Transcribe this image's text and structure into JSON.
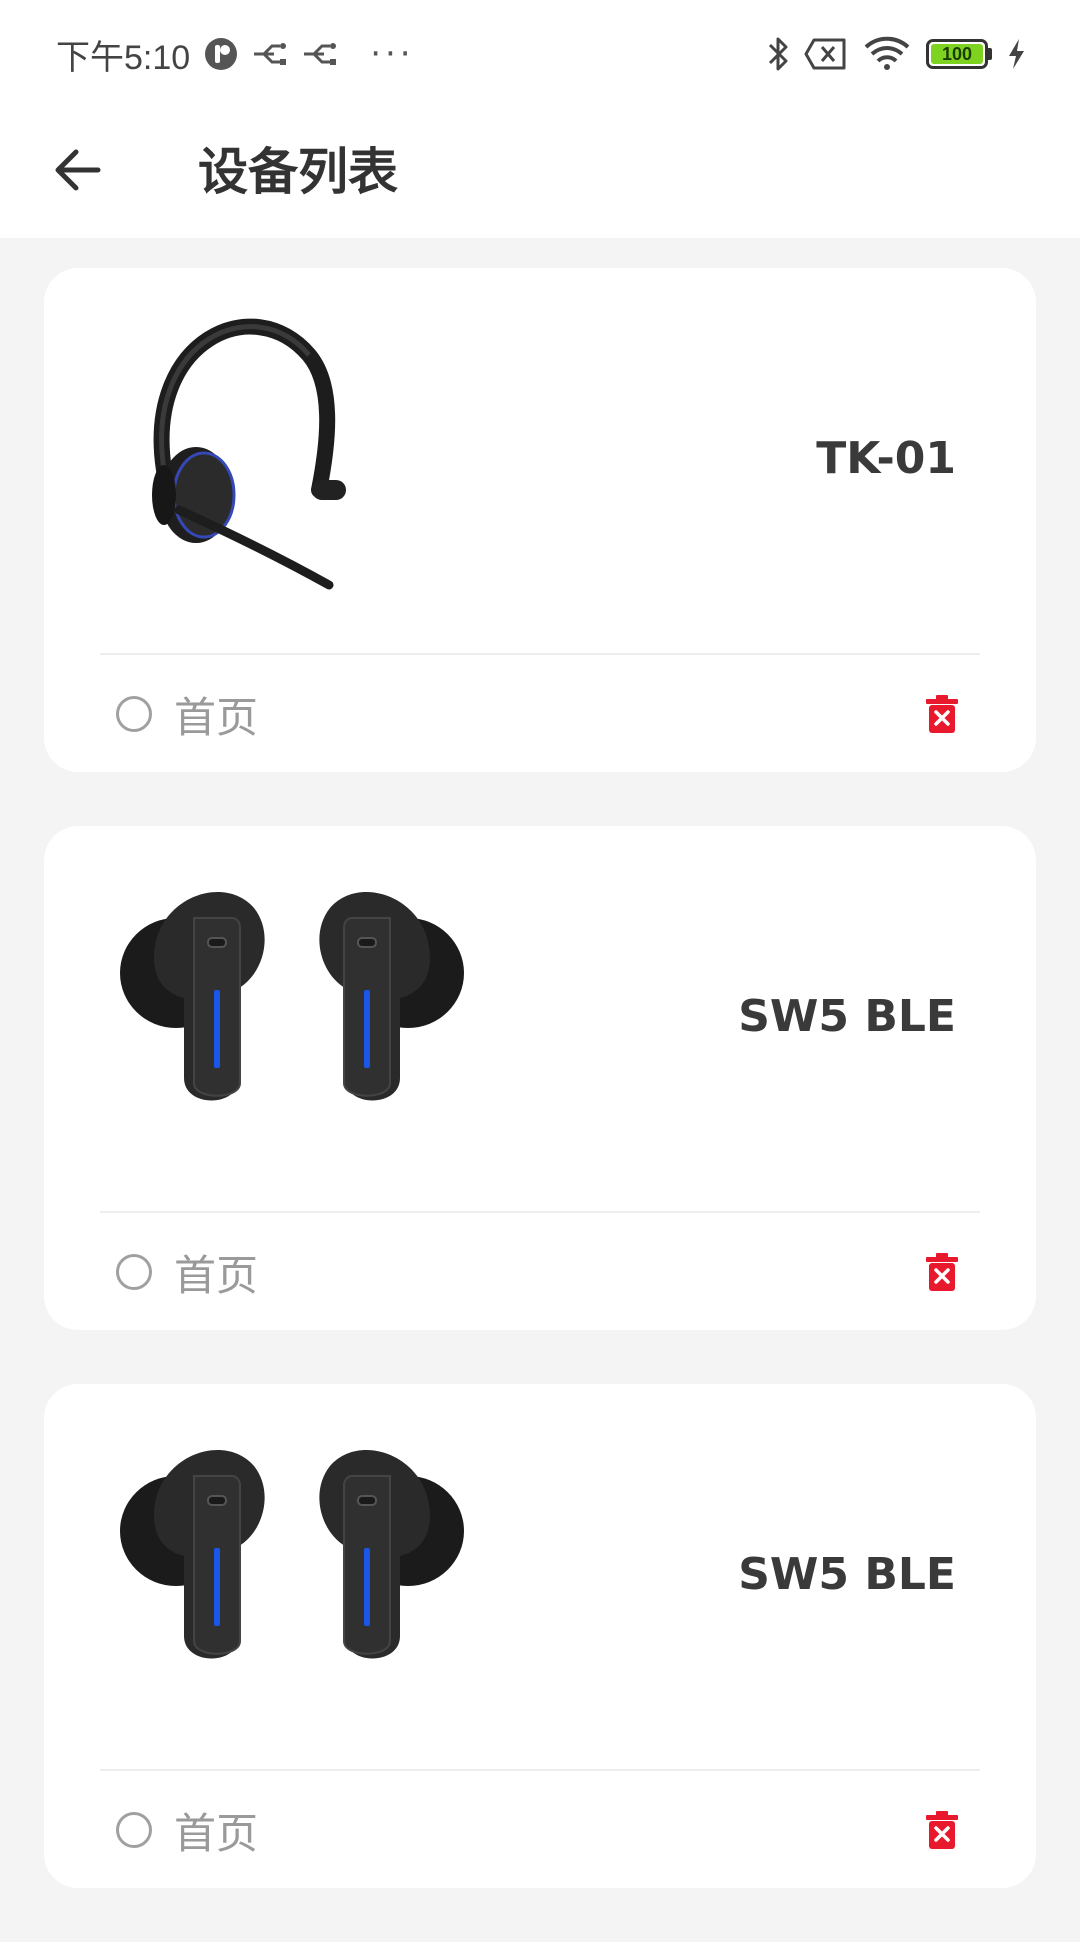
{
  "status_bar": {
    "time": "下午5:10",
    "dots": "···",
    "battery_level": "100",
    "icons": [
      "app-notification-icon",
      "usb-share-icon",
      "usb-share-icon",
      "bluetooth-icon",
      "sim-error-icon",
      "wifi-icon",
      "battery-icon",
      "charging-icon"
    ]
  },
  "header": {
    "back_icon": "arrow-left-icon",
    "title": "设备列表"
  },
  "devices": [
    {
      "name": "TK-01",
      "image": "headset-image",
      "home_label": "首页",
      "selected": false
    },
    {
      "name": "SW5 BLE",
      "image": "earbuds-image",
      "home_label": "首页",
      "selected": false
    },
    {
      "name": "SW5 BLE",
      "image": "earbuds-image",
      "home_label": "首页",
      "selected": false
    }
  ],
  "colors": {
    "background": "#f4f4f4",
    "card": "#ffffff",
    "delete_red": "#e8192c",
    "earbud_accent": "#1a56e8",
    "battery_green": "#7ed321"
  }
}
